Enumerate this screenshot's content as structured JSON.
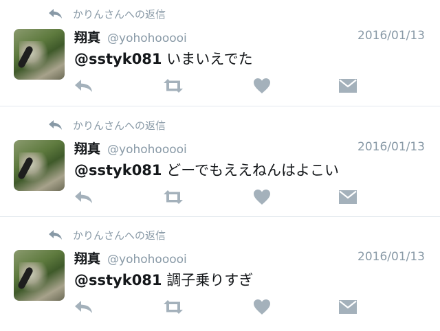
{
  "tweets": [
    {
      "reply_context": "かりんさんへの返信",
      "name": "翔真",
      "handle": "@yohohooooi",
      "date": "2016/01/13",
      "mention": "@sstyk081",
      "text": " いまいえでた"
    },
    {
      "reply_context": "かりんさんへの返信",
      "name": "翔真",
      "handle": "@yohohooooi",
      "date": "2016/01/13",
      "mention": "@sstyk081",
      "text": " どーでもええねんはよこい"
    },
    {
      "reply_context": "かりんさんへの返信",
      "name": "翔真",
      "handle": "@yohohooooi",
      "date": "2016/01/13",
      "mention": "@sstyk081",
      "text": " 調子乗りすぎ"
    }
  ],
  "icons": {
    "reply_context": "reply-arrow-icon",
    "actions": [
      "reply-icon",
      "retweet-icon",
      "like-heart-icon",
      "direct-message-icon"
    ]
  },
  "colors": {
    "muted": "#8899a6",
    "icon": "#a4b1bb",
    "text": "#14171a",
    "divider": "#e1e8ed"
  }
}
